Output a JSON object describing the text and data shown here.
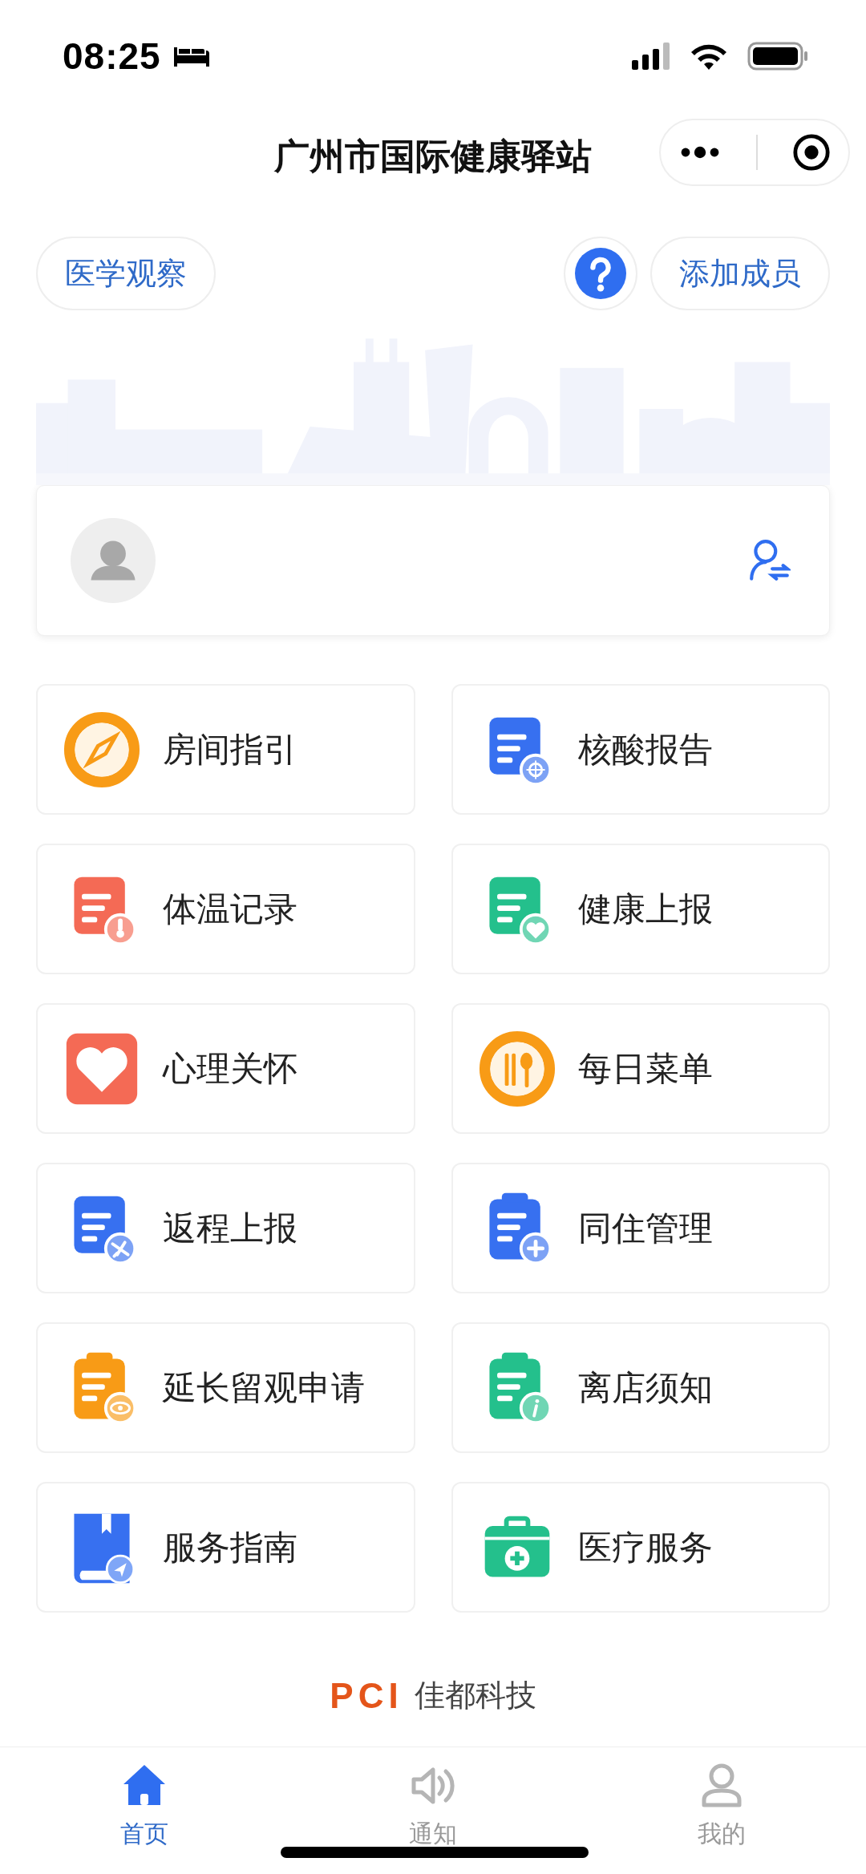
{
  "status_bar": {
    "time": "08:25"
  },
  "title_bar": {
    "title": "广州市国际健康驿站"
  },
  "actions": {
    "left_button": "医学观察",
    "right_button": "添加成员"
  },
  "menu": [
    {
      "label": "房间指引",
      "kind": "compass",
      "color": "#f89b16"
    },
    {
      "label": "核酸报告",
      "kind": "doc-target",
      "color": "#3770f0"
    },
    {
      "label": "体温记录",
      "kind": "doc-thermo",
      "color": "#f46a55"
    },
    {
      "label": "健康上报",
      "kind": "doc-heart",
      "color": "#24c08c"
    },
    {
      "label": "心理关怀",
      "kind": "heart",
      "color": "#f46a55"
    },
    {
      "label": "每日菜单",
      "kind": "meal",
      "color": "#f89b16"
    },
    {
      "label": "返程上报",
      "kind": "doc-plane",
      "color": "#3770f0"
    },
    {
      "label": "同住管理",
      "kind": "clip-plus",
      "color": "#3770f0"
    },
    {
      "label": "延长留观申请",
      "kind": "clip-eye",
      "color": "#f89b16"
    },
    {
      "label": "离店须知",
      "kind": "clip-info",
      "color": "#24c08c"
    },
    {
      "label": "服务指南",
      "kind": "book",
      "color": "#3770f0"
    },
    {
      "label": "医疗服务",
      "kind": "medkit",
      "color": "#24c08c"
    }
  ],
  "footer": {
    "logo": "PCI",
    "company": "佳都科技"
  },
  "tab_bar": [
    {
      "label": "首页",
      "kind": "home",
      "selected": true
    },
    {
      "label": "通知",
      "kind": "speaker",
      "selected": false
    },
    {
      "label": "我的",
      "kind": "person",
      "selected": false
    }
  ]
}
